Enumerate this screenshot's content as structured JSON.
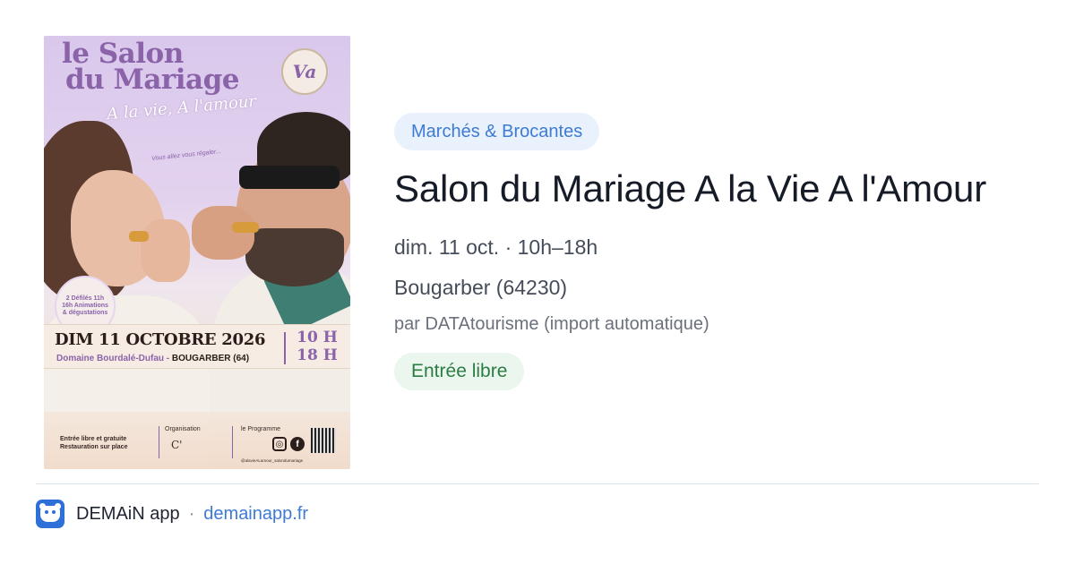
{
  "poster": {
    "title_line1": "le Salon",
    "title_line2": "du Mariage",
    "script": "A la vie, A l'amour",
    "tagline": "Vous allez vous régaler...",
    "logo_text": "Va",
    "badge": "2 Défilés 11h 16h Animations & dégustations",
    "date": "DIM 11 OCTOBRE 2026",
    "place_prefix": "Domaine Bourdalé-Dufau - ",
    "place_city": "BOUGARBER (64)",
    "hours_start": "10 H",
    "hours_end": "18 H",
    "foot_left_line1": "Entrée libre et gratuite",
    "foot_left_line2": "Restauration sur place",
    "org_label": "Organisation",
    "org_logo": "C'",
    "program_label": "le Programme",
    "handle": "@alavieALamour_salondumariage",
    "icons": [
      "instagram-icon",
      "facebook-icon",
      "qr-code-icon"
    ]
  },
  "event": {
    "category": "Marchés & Brocantes",
    "title": "Salon du Mariage A la Vie A l'Amour",
    "when": "dim. 11 oct. · 10h–18h",
    "where": "Bougarber (64230)",
    "source": "par DATAtourisme (import automatique)",
    "price": "Entrée libre"
  },
  "footer": {
    "app_name": "DEMAiN app",
    "separator": "·",
    "domain": "demainapp.fr"
  },
  "colors": {
    "accent_blue": "#3e7bd4",
    "pill_blue_bg": "#e9f1fc",
    "green_text": "#2c7d43",
    "pill_green_bg": "#eaf6ee",
    "poster_purple": "#8a63a9"
  }
}
